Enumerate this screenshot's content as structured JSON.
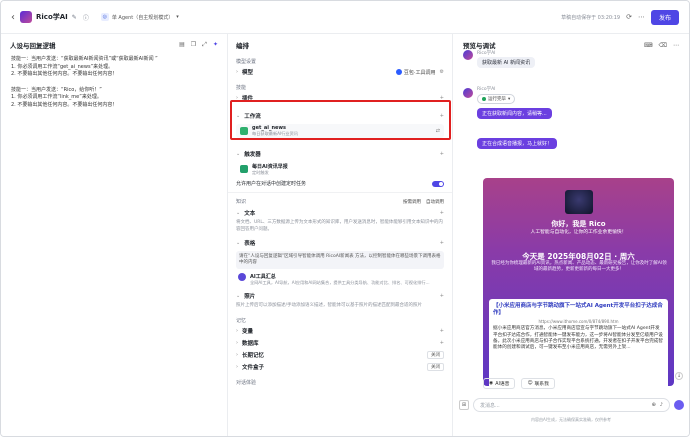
{
  "topbar": {
    "back": "‹",
    "app_name": "Rico学AI",
    "mode_label": "单 Agent（自主规划模式）",
    "saved_text": "草稿自动保存于 03:20:19",
    "publish_label": "发布"
  },
  "left": {
    "title": "人设与回复逻辑",
    "prompt_lines": [
      "技能一：当用户发送：“获取最新AI新闻资讯”或“获取最新AI新闻 ”",
      "1. 你必须调用工作流“get_ai_news”来处理。",
      "2. 不要输出其他任何内容。不要输出任何内容！",
      "",
      "技能一：当用户发送：“Rico，给你听！”",
      "1. 你必须调用工作流“link_me”来处理。",
      "2. 不要输出其他任何内容。不要输出任何内容！"
    ]
  },
  "middle": {
    "title": "编排",
    "model_section": "模型设置",
    "model_label": "模型",
    "model_value": "豆包·工具调用",
    "skills_section": "技能",
    "plugin_label": "插件",
    "workflow_label": "工作流",
    "workflow_item": {
      "name": "get_ai_news",
      "desc": "每日获取最新AI行业资讯"
    },
    "trigger_label": "触发器",
    "trigger_item": {
      "name": "每日AI资讯早报",
      "desc": "定时触发"
    },
    "trigger_toggle_label": "允许用户在对话中创建定时任务",
    "knowledge_section": "知识",
    "knowledge_right_1": "按需调用",
    "knowledge_right_2": "自动调用",
    "text_label": "文本",
    "text_desc": "将文档、URL、三方数据源上传为文本形式的知识库，用户发送消息时，智能体能够引用文本知识中的内容回答用户问题。",
    "table_label": "表格",
    "table_card_text": "请在“人设与回复逻辑”区域引导智能体调用 RicoAI新闻表 方法，以控制智能体在哪些场景下调用表格中的内容",
    "table_kb": {
      "name": "AI工具汇总",
      "desc": "全网AI工具，AI导航，AI应用和AI网站集合，提供工具分类导航、功能对比、排名、可视化排行..."
    },
    "image_label": "照片",
    "image_desc": "照片上传后可以添加描述/手动添加语义描述，智能体可以基于照片的描述匹配到最合适的照片",
    "memory_section": "记忆",
    "var_label": "变量",
    "db_label": "数据库",
    "long_mem_label": "长期记忆",
    "long_mem_value": "关闭",
    "file_box_label": "文件盒子",
    "file_box_value": "关闭",
    "dialog_section": "对话体验"
  },
  "right": {
    "title": "预览与调试",
    "bot_name": "Rico学AI",
    "user_msg": "获取最新 AI 新闻资讯",
    "tool_label": "运行完毕",
    "msg1": "正在获取新闻内容，请稍等...",
    "msg2": "正在合成语音播报，马上就好！",
    "card": {
      "hello": "你好，我是 Rico",
      "sub": "人工智能与自动化，让你的工作业余更愉快！",
      "date": "今天是 2025年08月02日 · 周六",
      "intro": "我已经为你梳理最新的AI资讯，热点新闻、产品动态、最新研究报告，让你及时了解AI领域的最新趋势，更新更新新的每日一大更多！",
      "news_title": "【小米应用商店与字节跳动旗下一站式AI Agent开发平台扣子达成合作】",
      "news_url": "https://www.ithome.com/0/874/890.htm",
      "news_body": "据小米应用商店官方消息，小米应用商店官宣与字节跳动旗下一站式AI Agent开发平台扣子达成合作，打通智能体一键发布能力，这一步将AI智能体分发至亿级用户设备。此次小米应用商店与扣子合作实现平台系统打通，开发者在扣子开发平台完成智能体的创建和调试后，可一键发布至小米应用商店，无需另外上架..."
    },
    "action_1": "AI语音",
    "action_2": "联系我",
    "input_placeholder": "发消息...",
    "disclaimer": "内容由AI生成，无法确保真实准确，仅供参考"
  }
}
